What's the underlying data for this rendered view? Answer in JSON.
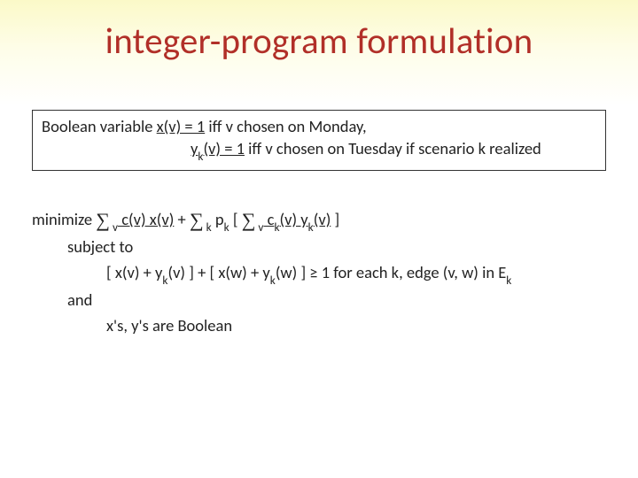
{
  "title": "integer-program formulation",
  "box": {
    "prefix": "Boolean variable ",
    "xv": "x(v) = 1",
    "line1_rest": " iff v chosen on Monday,",
    "ykv": "y",
    "yk_sub": "k",
    "ykv_rest": "(v) = 1",
    "line2_rest": " iff v chosen on Tuesday if scenario k realized"
  },
  "body": {
    "minimize": "minimize ",
    "sigma": "∑",
    "sub_v": " v",
    "cv_xv": " c(v) x(v)",
    "plus1": " + ",
    "sub_k": " k",
    "pk_open": " p",
    "pk_sub": "k",
    "bracket_open": " [ ",
    "ckv": " c",
    "ck_sub": "k",
    "ckv_rest": "(v) y",
    "yk_sub": "k",
    "ykv_rest": "(v)",
    "bracket_close": " ]",
    "subject_to": "subject to",
    "constraint_a": "[ x(v) + y",
    "constraint_a2": "(v) ] + [ x(w) + y",
    "constraint_a3": "(w) ]  ≥ 1   for each k, edge (v, w) in E",
    "ek_sub": "k",
    "and": "and",
    "boolean": "x's, y's are Boolean"
  }
}
